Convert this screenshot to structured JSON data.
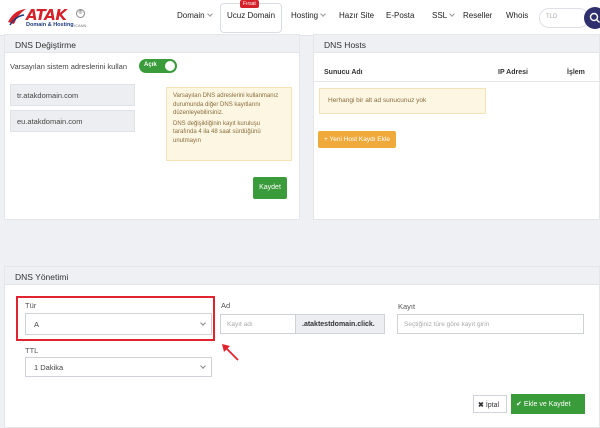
{
  "nav": {
    "logo_text": "ATAK",
    "logo_tagline": "Domain & Hosting",
    "logo_icann": "ICANN",
    "items": [
      "Domain",
      "Ucuz Domain",
      "Hosting",
      "Hazır Site",
      "E-Posta",
      "SSL",
      "Reseller",
      "Whois"
    ],
    "firsat_badge": "Fırsat",
    "tld_placeholder": "TLD"
  },
  "dns_change": {
    "title": "DNS Değiştirme",
    "default_label": "Varsayılan sistem adreslerini kullan",
    "toggle_label": "Açık",
    "toggle_on": true,
    "ns1": "tr.atakdomain.com",
    "ns2": "eu.atakdomain.com",
    "warning_line1": "Varsayılan DNS adreslerini kullanmanız durumunda diğer DNS kayıtlarını düzenleyebilirsiniz.",
    "warning_line2": "DNS değişikliğinin kayıt kuruluşu tarafında 4 ila 48 saat sürdüğünü unutmayın",
    "save_label": "Kaydet"
  },
  "dns_hosts": {
    "title": "DNS Hosts",
    "columns": [
      "Sunucu Adı",
      "IP Adresi",
      "İşlem"
    ],
    "empty_text": "Herhangi bir alt ad sunucunuz yok",
    "add_label": "+ Yeni Host Kaydı Ekle"
  },
  "dns_management": {
    "title": "DNS Yönetimi",
    "type_label": "Tür",
    "type_value": "A",
    "name_label": "Ad",
    "name_placeholder": "Kayıt adı",
    "domain_suffix": ".ataktestdomain.click.",
    "record_label": "Kayıt",
    "record_placeholder": "Seçtiğiniz türe göre kayıt girin",
    "ttl_label": "TTL",
    "ttl_value": "1 Dakika",
    "cancel_label": "İptal",
    "save_label": "Ekle ve Kaydet"
  },
  "colors": {
    "brand_red": "#d4212a",
    "green": "#3a9b3a",
    "orange": "#f0a93b",
    "highlight": "#e0232e"
  }
}
